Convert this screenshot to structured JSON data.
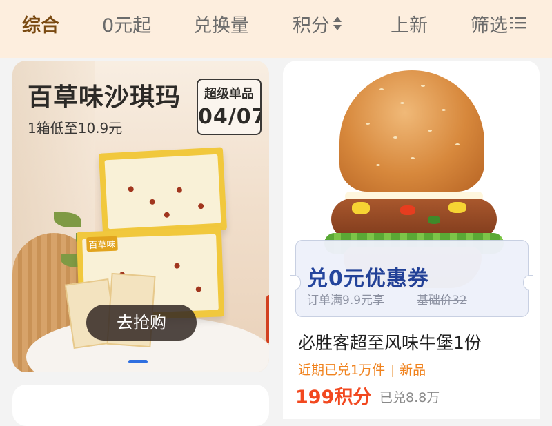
{
  "tabs": [
    {
      "label": "综合",
      "active": true
    },
    {
      "label": "0元起",
      "active": false
    },
    {
      "label": "兑换量",
      "active": false
    },
    {
      "label": "积分",
      "active": false,
      "icon": "sort-icon"
    },
    {
      "label": "上新",
      "active": false
    },
    {
      "label": "筛选",
      "active": false,
      "icon": "filter-icon"
    }
  ],
  "left_card": {
    "title": "百草味沙琪玛",
    "subtitle": "1箱低至10.9元",
    "badge_top": "超级单品",
    "badge_date": "04/07",
    "button": "去抢购",
    "brand_on_box": "百草味"
  },
  "right_card": {
    "coupon_title": "兑0元优惠券",
    "coupon_condition": "订单满9.9元享",
    "coupon_base_price": "基础价32",
    "name": "必胜客超至风味牛堡1份",
    "tag_1": "近期已兑1万件",
    "tag_2": "新品",
    "price": "199积分",
    "sold": "已兑8.8万"
  },
  "colors": {
    "tab_bar_bg": "#fdeede",
    "active_tab": "#7a4a12",
    "coupon_title": "#1d3f9a",
    "price": "#f2481f",
    "tag": "#f0821d",
    "pager_indicator": "#2f6fe0"
  }
}
